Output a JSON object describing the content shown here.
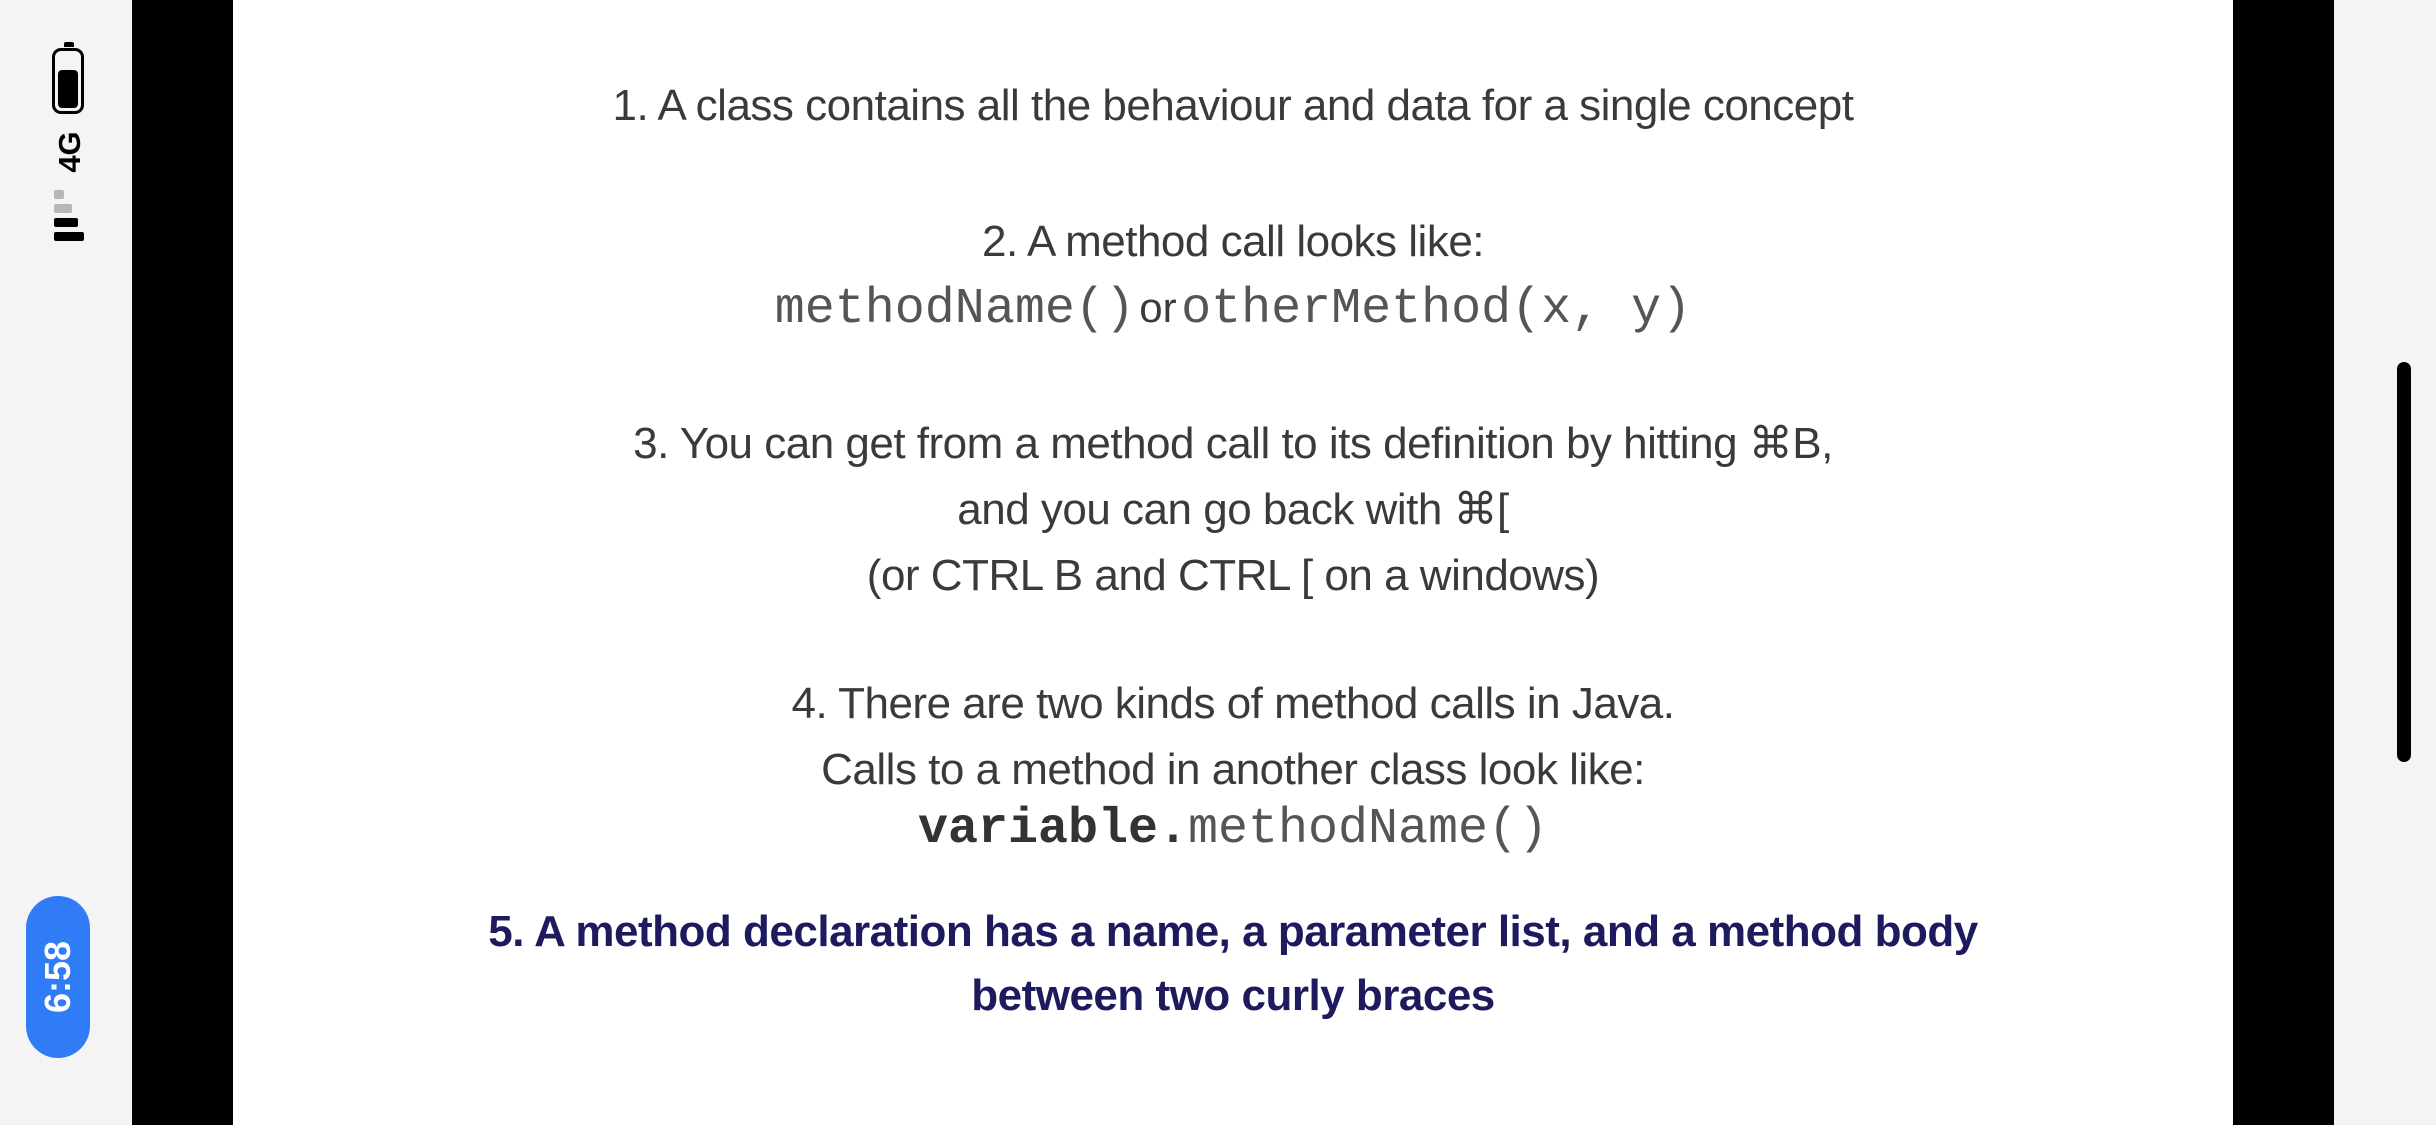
{
  "status_bar": {
    "network": "4G",
    "time": "6:58",
    "battery_level": 0.7,
    "signal_bars": 2,
    "signal_bars_total": 4
  },
  "slide": {
    "item1": "1. A class contains all the behaviour and data for a single concept",
    "item2": {
      "text": "2. A method call looks like:",
      "code_a": "methodName()",
      "separator": "or",
      "code_b": "otherMethod(x, y)"
    },
    "item3": {
      "line1": "3. You can get from a method call to its definition by hitting ⌘B,",
      "line2": "and you can go back with ⌘[",
      "line3": "(or CTRL B and CTRL [ on a windows)"
    },
    "item4": {
      "line1": "4. There are two kinds of method calls in Java.",
      "line2": "Calls to a method in another class look like:",
      "code_bold": "variable.",
      "code": "methodName()"
    },
    "item5": {
      "line1": "5. A method declaration has a name, a parameter list, and a method body",
      "line2": "between two curly braces",
      "color": "#1e1a5e"
    }
  }
}
